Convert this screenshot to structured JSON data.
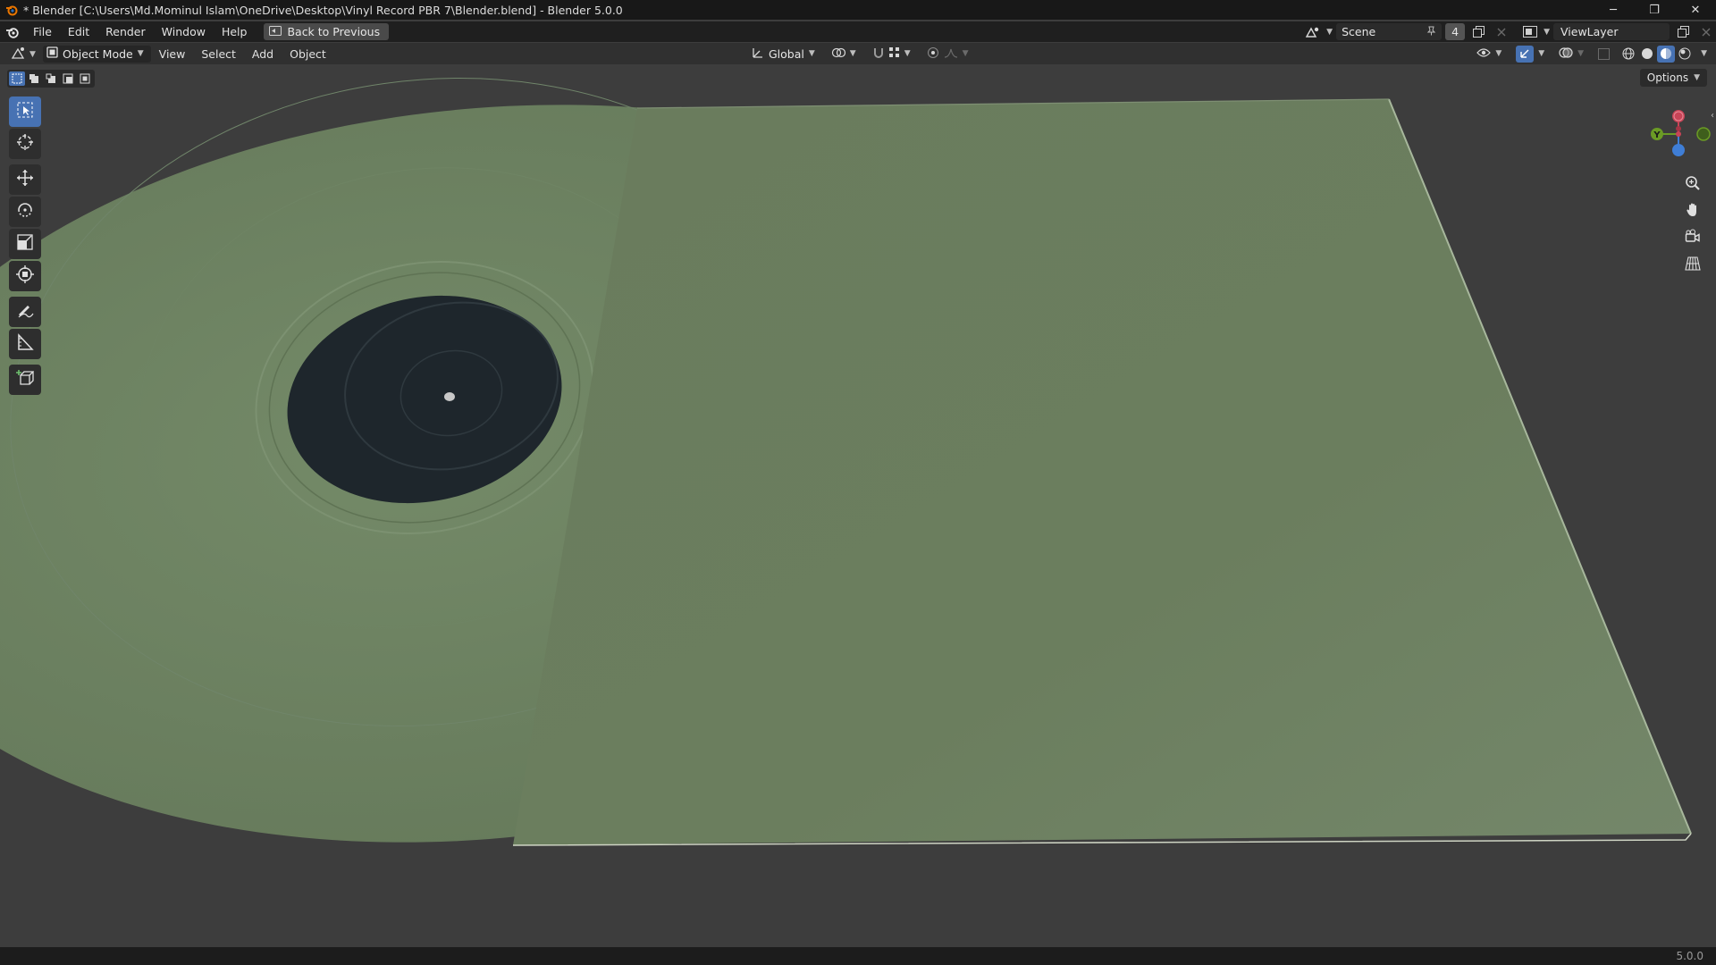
{
  "window": {
    "title": "* Blender [C:\\Users\\Md.Mominul Islam\\OneDrive\\Desktop\\Vinyl Record PBR 7\\Blender.blend] - Blender 5.0.0",
    "minimize": "─",
    "maximize": "❐",
    "close": "✕"
  },
  "menu": {
    "items": [
      "File",
      "Edit",
      "Render",
      "Window",
      "Help"
    ],
    "back_button": "Back to Previous"
  },
  "scene": {
    "name": "Scene",
    "count": "4",
    "view_layer": "ViewLayer"
  },
  "viewport_header": {
    "mode": "Object Mode",
    "menus": [
      "View",
      "Select",
      "Add",
      "Object"
    ],
    "orientation": "Global"
  },
  "options_label": "Options",
  "gizmo": {
    "y_label": "Y"
  },
  "status": {
    "version": "5.0.0"
  },
  "colors": {
    "accent": "#4772b3",
    "sleeve": "#6b7d5d",
    "record": "#6f8463",
    "label": "#1d252c",
    "axis_x": "#c84457",
    "axis_y": "#6b9b25",
    "axis_z": "#3f7ed6"
  },
  "toolbar_icons": [
    "select-box-icon",
    "cursor-icon",
    "move-icon",
    "rotate-icon",
    "scale-icon",
    "transform-icon",
    "annotate-icon",
    "measure-icon",
    "add-cube-icon"
  ]
}
